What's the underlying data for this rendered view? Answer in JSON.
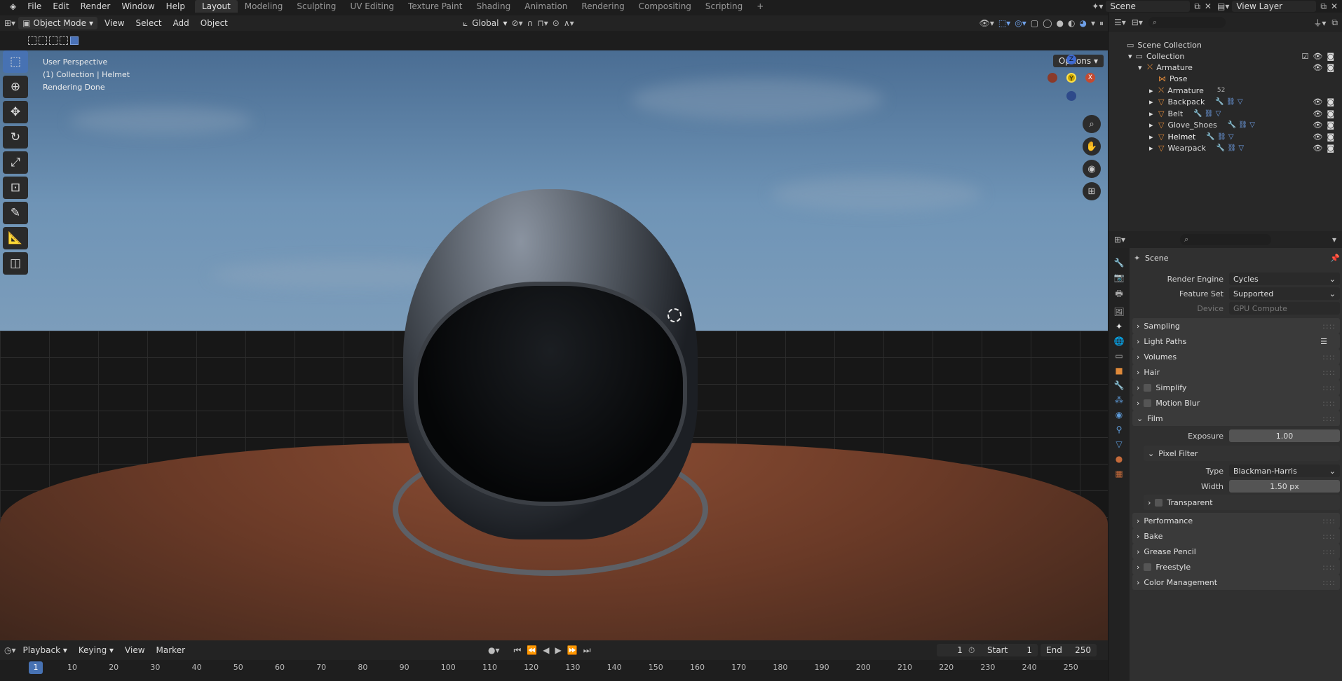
{
  "topbar": {
    "menu": [
      "File",
      "Edit",
      "Render",
      "Window",
      "Help"
    ],
    "workspaces": [
      "Layout",
      "Modeling",
      "Sculpting",
      "UV Editing",
      "Texture Paint",
      "Shading",
      "Animation",
      "Rendering",
      "Compositing",
      "Scripting"
    ],
    "active_workspace": "Layout",
    "add_workspace": "+",
    "scene": "Scene",
    "view_layer": "View Layer"
  },
  "viewport_header": {
    "mode": "Object Mode",
    "menus": [
      "View",
      "Select",
      "Add",
      "Object"
    ],
    "orientation": "Global",
    "options": "Options"
  },
  "viewport": {
    "info": [
      "User Perspective",
      "(1) Collection | Helmet",
      "Rendering Done"
    ],
    "gizmo": {
      "x": "X",
      "y": "Y",
      "z": "Z"
    }
  },
  "timeline": {
    "menus": [
      "Playback",
      "Keying",
      "View",
      "Marker"
    ],
    "current_frame": "1",
    "start_label": "Start",
    "start": "1",
    "end_label": "End",
    "end": "250",
    "ticks": [
      "1",
      "10",
      "20",
      "30",
      "40",
      "50",
      "60",
      "70",
      "80",
      "90",
      "100",
      "110",
      "120",
      "130",
      "140",
      "150",
      "160",
      "170",
      "180",
      "190",
      "200",
      "210",
      "220",
      "230",
      "240",
      "250"
    ]
  },
  "outliner": {
    "root": "Scene Collection",
    "collection": "Collection",
    "items": [
      {
        "name": "Armature",
        "level": 2,
        "expanded": true
      },
      {
        "name": "Pose",
        "level": 3
      },
      {
        "name": "Armature",
        "level": 3,
        "badge": "52"
      },
      {
        "name": "Backpack",
        "level": 3
      },
      {
        "name": "Belt",
        "level": 3
      },
      {
        "name": "Glove_Shoes",
        "level": 3
      },
      {
        "name": "Helmet",
        "level": 3
      },
      {
        "name": "Wearpack",
        "level": 3
      }
    ]
  },
  "properties": {
    "context": "Scene",
    "render_engine_label": "Render Engine",
    "render_engine": "Cycles",
    "feature_set_label": "Feature Set",
    "feature_set": "Supported",
    "device_label": "Device",
    "device": "GPU Compute",
    "panels": [
      "Sampling",
      "Light Paths",
      "Volumes",
      "Hair",
      "Simplify",
      "Motion Blur",
      "Film"
    ],
    "exposure_label": "Exposure",
    "exposure": "1.00",
    "pixel_filter": "Pixel Filter",
    "type_label": "Type",
    "type": "Blackman-Harris",
    "width_label": "Width",
    "width": "1.50 px",
    "transparent": "Transparent",
    "panels_after": [
      "Performance",
      "Bake",
      "Grease Pencil",
      "Freestyle",
      "Color Management"
    ]
  },
  "colors": {
    "accent": "#4772b3",
    "bg": "#1d1d1d",
    "panel": "#303030"
  }
}
